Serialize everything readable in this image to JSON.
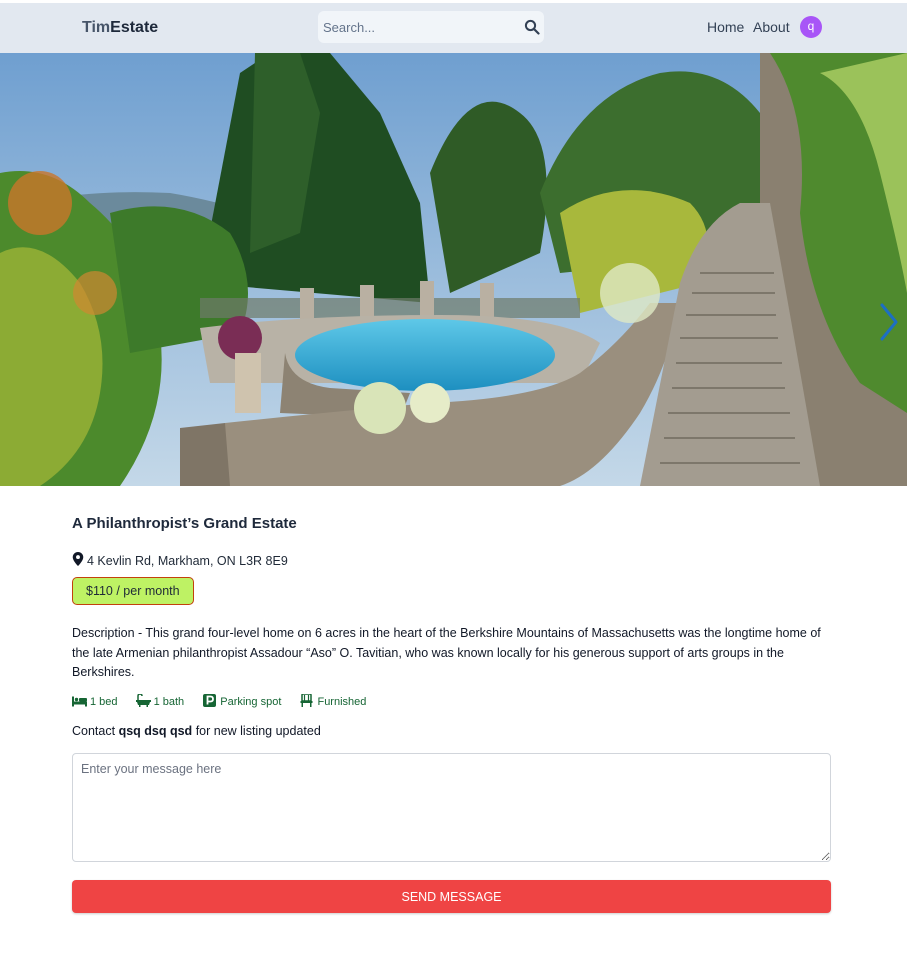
{
  "header": {
    "logo_part1": "Tim",
    "logo_part2": "Estate",
    "search_placeholder": "Search...",
    "nav": {
      "home": "Home",
      "about": "About"
    },
    "avatar_letter": "q"
  },
  "listing": {
    "title": "A Philanthropist’s Grand Estate",
    "address": "4 Kevlin Rd, Markham, ON L3R 8E9",
    "price": "$110 / per month",
    "description": "Description - This grand four-level home on 6 acres in the heart of the Berkshire Mountains of Massachusetts was the longtime home of the late Armenian philanthropist Assadour “Aso” O. Tavitian, who was known locally for his generous support of arts groups in the Berkshires.",
    "features": {
      "beds": "1 bed",
      "baths": "1 bath",
      "parking": "Parking spot",
      "furnished": "Furnished"
    },
    "icons": [
      "map-pin-icon",
      "bed-icon",
      "bath-icon",
      "parking-icon",
      "chair-icon",
      "search-icon",
      "chevron-right-icon"
    ]
  },
  "contact": {
    "prefix": "Contact",
    "landlord_name": "qsq dsq qsd",
    "suffix": "for new listing updated",
    "message_placeholder": "Enter your message here",
    "send_label": "Send Message"
  },
  "colors": {
    "header_bg": "#e2e8f0",
    "avatar_bg": "#a855f7",
    "price_bg": "#bef264",
    "price_border": "#c2410c",
    "feature_text": "#166534",
    "send_button": "#ef4444"
  }
}
